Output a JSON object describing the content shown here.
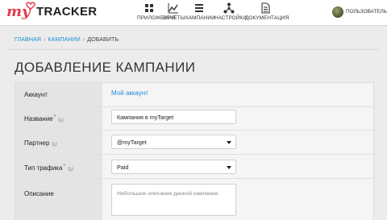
{
  "header": {
    "logo_prefix": "my",
    "logo_brand": "TRACKER",
    "nav": [
      {
        "label": "ПРИЛОЖЕНИЯ",
        "icon": "apps-grid-icon"
      },
      {
        "label": "ОТЧЁТЫ",
        "icon": "chart-line-icon"
      },
      {
        "label": "КАМПАНИИ",
        "icon": "list-icon"
      },
      {
        "label": "НАСТРОЙКИ",
        "icon": "network-icon"
      },
      {
        "label": "ДОКУМЕНТАЦИЯ",
        "icon": "document-icon"
      }
    ],
    "user_name": "ПОЛЬЗОВАТЕЛЬ"
  },
  "breadcrumb": {
    "items": [
      "ГЛАВНАЯ",
      "КАМПАНИИ"
    ],
    "separator": "›",
    "current": "ДОБАВИТЬ"
  },
  "page_title": "ДОБАВЛЕНИЕ КАМПАНИИ",
  "form": {
    "account": {
      "label": "Аккаунт",
      "value": "Мой аккаунт"
    },
    "name": {
      "label": "Название",
      "required_mark": "*",
      "help": "?",
      "value": "Кампания в myTarget"
    },
    "partner": {
      "label": "Партнер",
      "help": "?",
      "value": "@myTarget"
    },
    "traffic_type": {
      "label": "Тип трафика",
      "required_mark": "*",
      "help": "?",
      "value": "Paid"
    },
    "description": {
      "label": "Описание",
      "placeholder": "Небольшое описание данной кампании"
    }
  },
  "colors": {
    "accent": "#e23a4a",
    "link": "#1e8fd6"
  }
}
